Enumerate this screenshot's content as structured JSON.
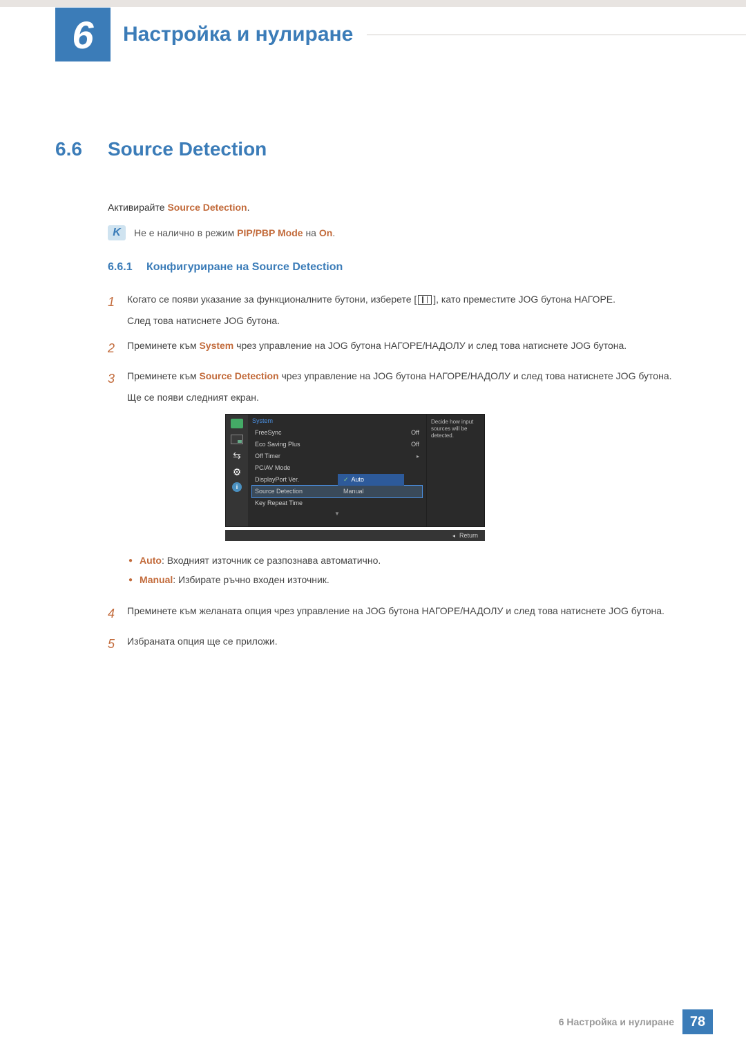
{
  "chapter": {
    "number": "6",
    "title": "Настройка и нулиране"
  },
  "section": {
    "number": "6.6",
    "title": "Source Detection"
  },
  "intro": {
    "prefix": "Активирайте ",
    "bold": "Source Detection",
    "suffix": "."
  },
  "note": {
    "prefix": "Не е налично в режим ",
    "orange1": "PIP/PBP Mode",
    "mid": " на ",
    "orange2": "On",
    "suffix": "."
  },
  "subsection": {
    "number": "6.6.1",
    "title": "Конфигуриране на Source Detection"
  },
  "steps": {
    "s1": {
      "num": "1",
      "t1": "Когато се появи указание за функционалните бутони, изберете [",
      "t2": "], като преместите JOG бутона НАГОРЕ.",
      "t3": "След това натиснете JOG бутона."
    },
    "s2": {
      "num": "2",
      "t1": "Преминете към ",
      "orange": "System",
      "t2": " чрез управление на JOG бутона НАГОРЕ/НАДОЛУ и след това натиснете JOG бутона."
    },
    "s3": {
      "num": "3",
      "t1": "Преминете към ",
      "orange": "Source Detection",
      "t2": " чрез управление на JOG бутона НАГОРЕ/НАДОЛУ и след това натиснете JOG бутона.",
      "t3": "Ще се появи следният екран."
    },
    "s4": {
      "num": "4",
      "text": "Преминете към желаната опция чрез управление на JOG бутона НАГОРЕ/НАДОЛУ и след това натиснете JOG бутона."
    },
    "s5": {
      "num": "5",
      "text": "Избраната опция ще се приложи."
    }
  },
  "bullets": {
    "auto": {
      "label": "Auto",
      "text": ": Входният източник се разпознава автоматично."
    },
    "manual": {
      "label": "Manual",
      "text": ": Избирате ръчно входен източник."
    }
  },
  "osd": {
    "menuTitle": "System",
    "items": {
      "freesync": {
        "label": "FreeSync",
        "value": "Off"
      },
      "eco": {
        "label": "Eco Saving Plus",
        "value": "Off"
      },
      "offtimer": {
        "label": "Off Timer",
        "arrow": "▸"
      },
      "pcav": {
        "label": "PC/AV Mode"
      },
      "dpver": {
        "label": "DisplayPort Ver."
      },
      "source": {
        "label": "Source Detection"
      },
      "keyrepeat": {
        "label": "Key Repeat Time"
      }
    },
    "submenu": {
      "auto": "Auto",
      "manual": "Manual"
    },
    "desc": "Decide how input sources will be detected.",
    "return": "Return"
  },
  "footer": {
    "text": "6 Настройка и нулиране",
    "page": "78"
  }
}
